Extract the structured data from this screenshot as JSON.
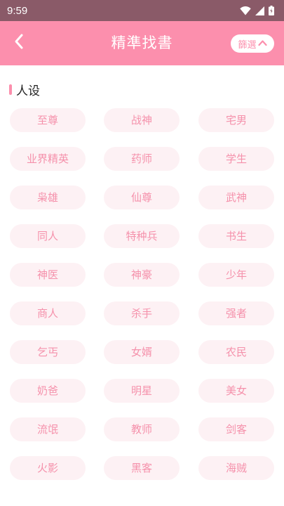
{
  "status_bar": {
    "time": "9:59",
    "icons": [
      "wifi-icon",
      "signal-icon",
      "battery-icon"
    ]
  },
  "header": {
    "title": "精準找書",
    "filter_label": "篩選",
    "background_color": "#fc8fad"
  },
  "section": {
    "title": "人设"
  },
  "tags": [
    "至尊",
    "战神",
    "宅男",
    "业界精英",
    "药师",
    "学生",
    "枭雄",
    "仙尊",
    "武神",
    "同人",
    "特种兵",
    "书生",
    "神医",
    "神豪",
    "少年",
    "商人",
    "杀手",
    "强者",
    "乞丐",
    "女婿",
    "农民",
    "奶爸",
    "明星",
    "美女",
    "流氓",
    "教师",
    "剑客",
    "火影",
    "黑客",
    "海贼"
  ],
  "colors": {
    "accent": "#fc8fad",
    "tag_background": "#fdf1f4",
    "tag_text": "#f591ab",
    "status_bar": "#8a5a68"
  }
}
